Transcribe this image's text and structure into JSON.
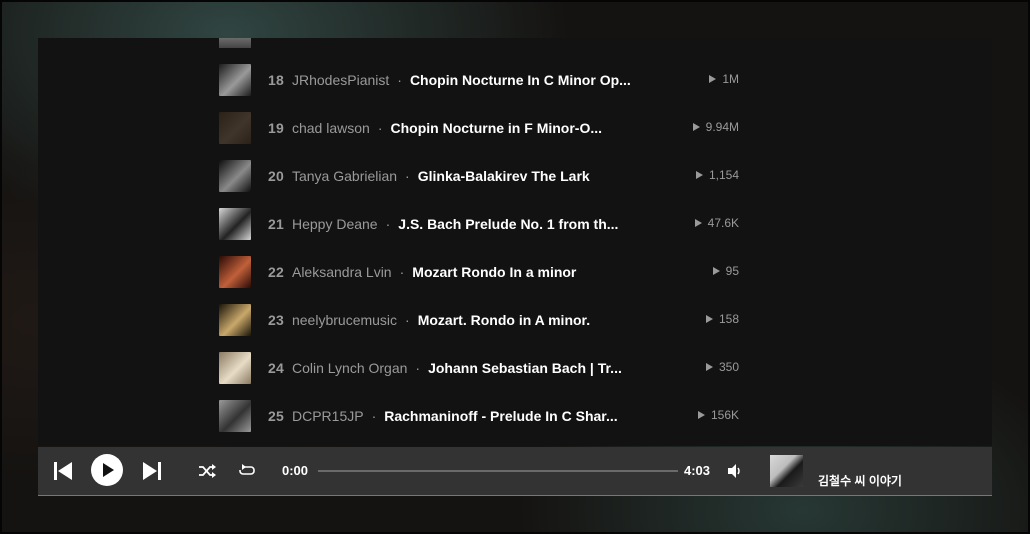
{
  "tracks": [
    {
      "num": "18",
      "artist": "JRhodesPianist",
      "title": "Chopin Nocturne In C Minor Op...",
      "plays": "1M",
      "thumb": [
        "#1c1c1c",
        "#9a9a9a"
      ]
    },
    {
      "num": "19",
      "artist": "chad lawson",
      "title": "Chopin Nocturne in F Minor-O...",
      "plays": "9.94M",
      "thumb": [
        "#2a2118",
        "#40352a"
      ]
    },
    {
      "num": "20",
      "artist": "Tanya Gabrielian",
      "title": "Glinka-Balakirev The Lark",
      "plays": "1,154",
      "thumb": [
        "#0e0e0e",
        "#8a8a8a"
      ]
    },
    {
      "num": "21",
      "artist": "Heppy Deane",
      "title": "J.S. Bach Prelude No. 1 from th...",
      "plays": "47.6K",
      "thumb": [
        "#d8d8d8",
        "#222222"
      ]
    },
    {
      "num": "22",
      "artist": "Aleksandra Lvin",
      "title": "Mozart Rondo In a minor",
      "plays": "95",
      "thumb": [
        "#2a0a05",
        "#c0603a"
      ]
    },
    {
      "num": "23",
      "artist": "neelybrucemusic",
      "title": "Mozart. Rondo in A minor.",
      "plays": "158",
      "thumb": [
        "#1a1408",
        "#c9a86a"
      ]
    },
    {
      "num": "24",
      "artist": "Colin Lynch Organ",
      "title": "Johann Sebastian Bach | Tr...",
      "plays": "350",
      "thumb": [
        "#8a7a62",
        "#e8dcc6"
      ]
    },
    {
      "num": "25",
      "artist": "DCPR15JP",
      "title": "Rachmaninoff - Prelude In C Shar...",
      "plays": "156K",
      "thumb": [
        "#9a9a9a",
        "#333333"
      ]
    }
  ],
  "player": {
    "current_time": "0:00",
    "duration": "4:03",
    "progress": 0,
    "now_playing_title": "김철수 씨 이야기"
  }
}
